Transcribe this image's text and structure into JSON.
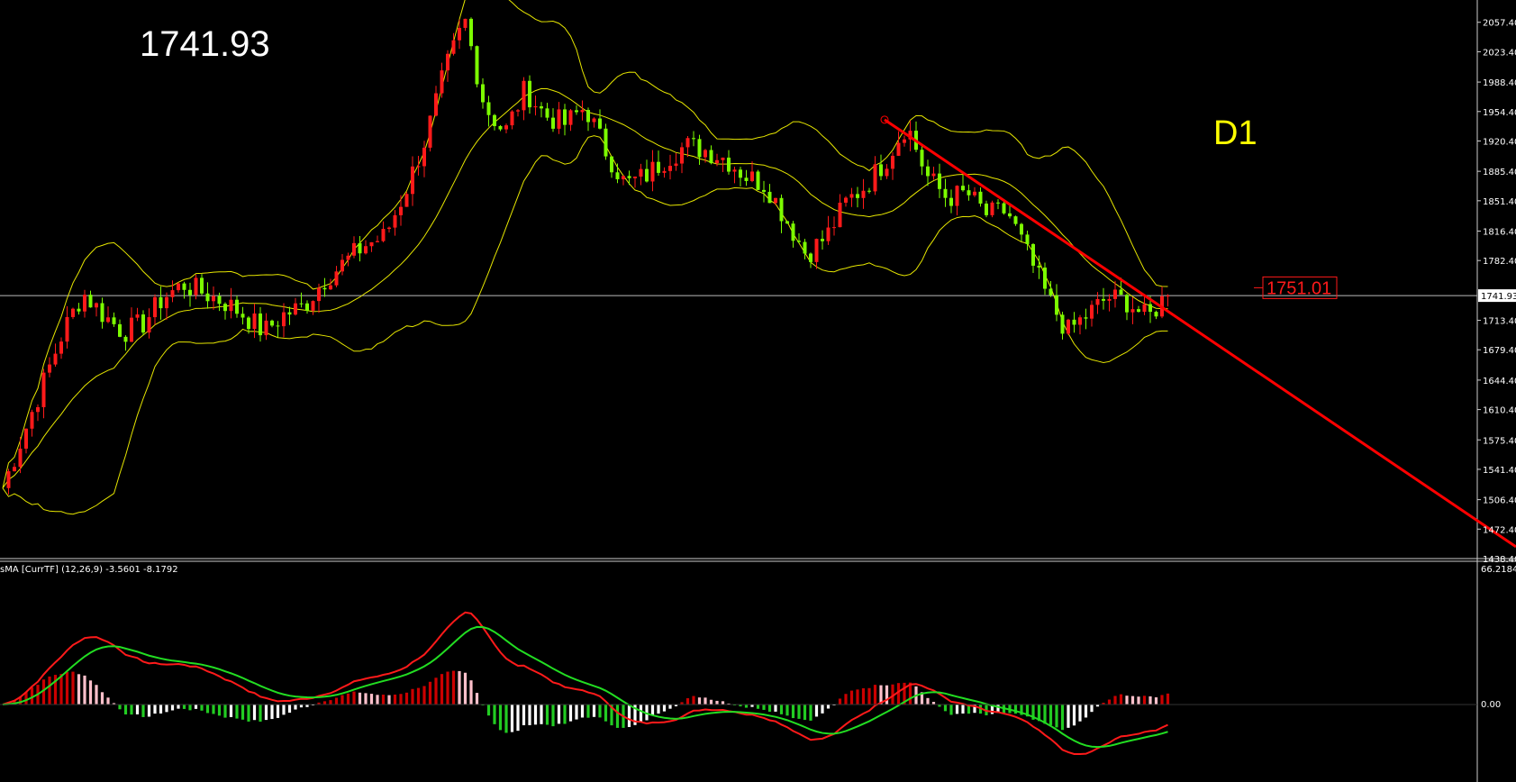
{
  "header": {
    "price": "1741.93",
    "timeframe": "D1"
  },
  "colors": {
    "background": "#000000",
    "bull": "#ff1a1a",
    "bear": "#7cfc00",
    "bands": "#e6e600",
    "trendline": "#ff0000",
    "macd": "#ff1a1a",
    "signal": "#22dd22",
    "hist_pos_up": "#cc0000",
    "hist_pos_down": "#ffc0cb",
    "hist_neg_down": "#22cc22",
    "hist_neg_up": "#ffffff",
    "grid": "#ffffff"
  },
  "price_axis": {
    "ticks": [
      "2057.40",
      "2023.40",
      "1988.40",
      "1954.40",
      "1920.40",
      "1885.40",
      "1851.40",
      "1816.40",
      "1782.40",
      "1713.40",
      "1679.40",
      "1644.40",
      "1610.40",
      "1575.40",
      "1541.40",
      "1506.40",
      "1472.40",
      "1438.40"
    ],
    "current_label": "1741.93"
  },
  "highlight_level": {
    "label": "1751.01"
  },
  "indicator": {
    "title": "sMA [CurrTF] (12,26,9) -3.5601 -8.1792",
    "max_label": "66.2184",
    "zero_label": "0.00"
  },
  "chart_data": {
    "type": "candlestick",
    "price_range": [
      1438.4,
      2080
    ],
    "current_price": 1741.93,
    "highlight_price": 1751.01,
    "bollinger": {
      "shown": true
    },
    "trendline": {
      "from_price": 1945,
      "to_price": 1452
    },
    "macd_range": [
      -90,
      150
    ],
    "key_path": [
      1520,
      1580,
      1640,
      1700,
      1745,
      1720,
      1700,
      1710,
      1740,
      1755,
      1745,
      1735,
      1720,
      1700,
      1720,
      1730,
      1760,
      1780,
      1800,
      1810,
      1860,
      1920,
      2000,
      2060,
      1960,
      1930,
      1980,
      1950,
      1940,
      1960,
      1910,
      1870,
      1880,
      1900,
      1915,
      1910,
      1900,
      1880,
      1870,
      1830,
      1790,
      1810,
      1850,
      1870,
      1900,
      1940,
      1880,
      1855,
      1860,
      1835,
      1840,
      1790,
      1740,
      1700,
      1720,
      1740,
      1735,
      1715,
      1745
    ]
  }
}
